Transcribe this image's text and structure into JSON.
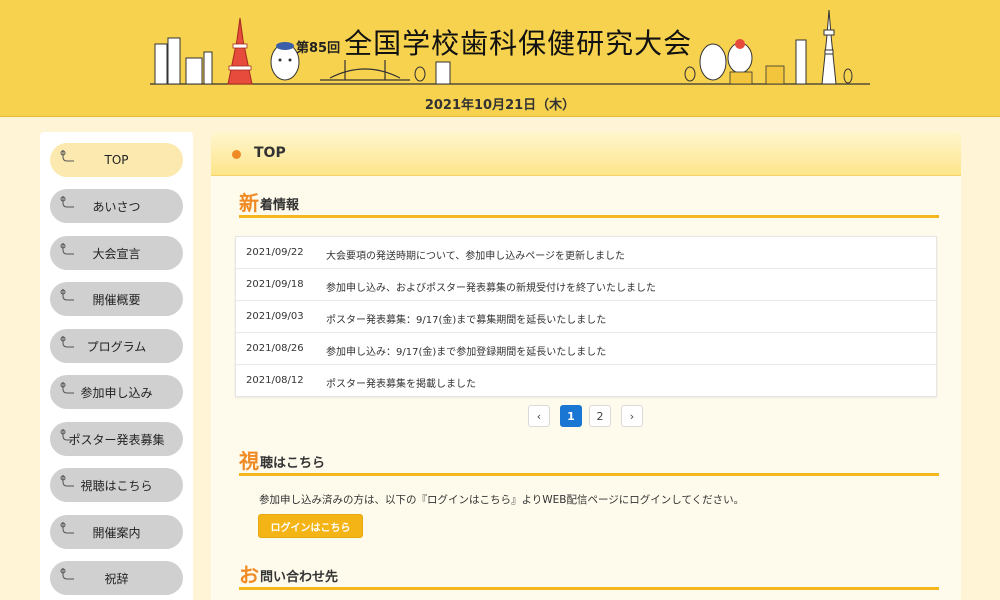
{
  "header": {
    "edition": "第85回",
    "title": "全国学校歯科保健研究大会",
    "date": "2021年10月21日（木）"
  },
  "sidebar": {
    "items": [
      {
        "label": "TOP",
        "active": true
      },
      {
        "label": "あいさつ"
      },
      {
        "label": "大会宣言"
      },
      {
        "label": "開催概要"
      },
      {
        "label": "プログラム"
      },
      {
        "label": "参加申し込み"
      },
      {
        "label": "ポスター発表募集"
      },
      {
        "label": "視聴はこちら"
      },
      {
        "label": "開催案内"
      },
      {
        "label": "祝辞"
      }
    ]
  },
  "main": {
    "page_title": "TOP",
    "news": {
      "title_first": "新",
      "title_rest": "着情報",
      "items": [
        {
          "date": "2021/09/22",
          "text": "大会要項の発送時期について、参加申し込みページを更新しました"
        },
        {
          "date": "2021/09/18",
          "text": "参加申し込み、およびポスター発表募集の新規受付けを終了いたしました"
        },
        {
          "date": "2021/09/03",
          "text": "ポスター発表募集：9/17(金)まで募集期間を延長いたしました"
        },
        {
          "date": "2021/08/26",
          "text": "参加申し込み：9/17(金)まで参加登録期間を延長いたしました"
        },
        {
          "date": "2021/08/12",
          "text": "ポスター発表募集を掲載しました"
        }
      ]
    },
    "pagination": {
      "prev": "‹",
      "pages": [
        "1",
        "2"
      ],
      "current_page": "1",
      "next": "›"
    },
    "viewing": {
      "title_first": "視",
      "title_rest": "聴はこちら",
      "text": "参加申し込み済みの方は、以下の『ログインはこちら』よりWEB配信ページにログインしてください。",
      "button_label": "ログインはこちら"
    },
    "contact": {
      "title_first": "お",
      "title_rest": "問い合わせ先"
    }
  },
  "colors": {
    "header_bg": "#f7d24f",
    "accent_orange": "#f08a24",
    "underline": "#f5b71d",
    "button": "#f5b415",
    "pager_active": "#1976d2"
  },
  "icons": [
    "tokyo-tower-illustration",
    "skytree-illustration",
    "bridge-illustration",
    "mascot-illustration",
    "chevron-left-icon",
    "chevron-right-icon"
  ]
}
